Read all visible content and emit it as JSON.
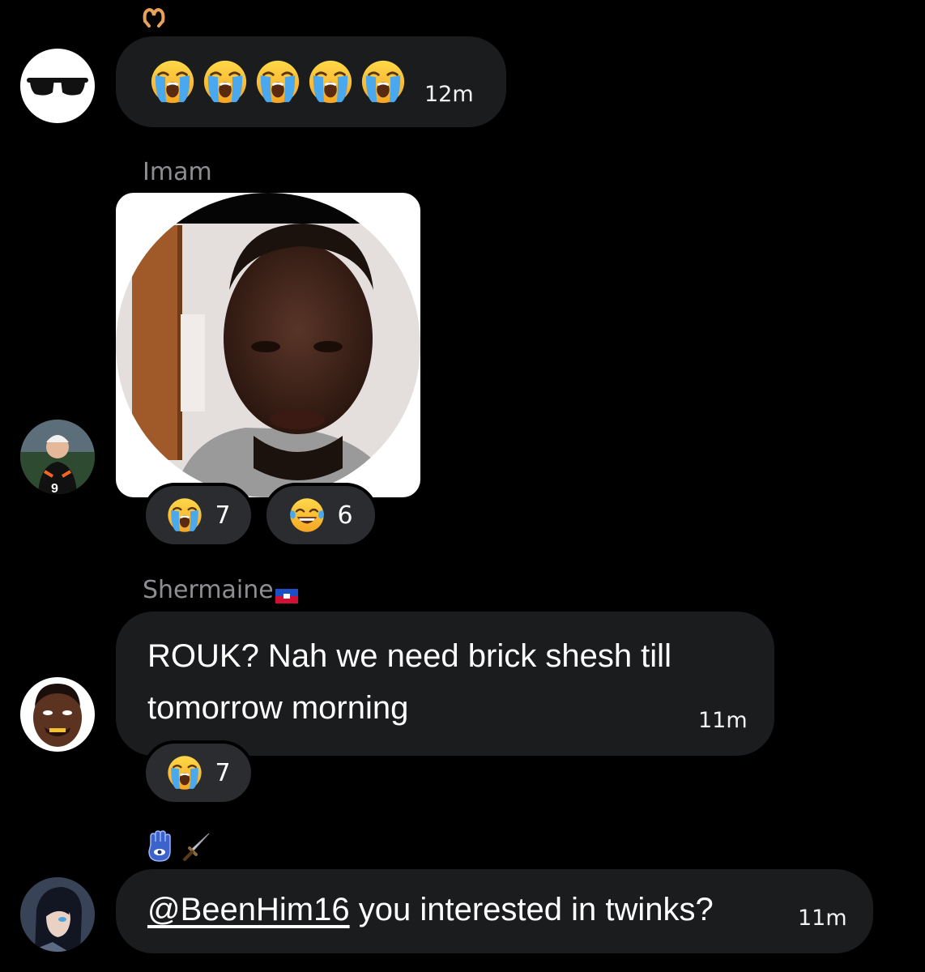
{
  "thread": {
    "messages": [
      {
        "id": "m1",
        "sender": "",
        "avatar_icon": "sunglasses-avatar-icon",
        "header_icon": "heart-hands-icon",
        "emojis": [
          "loudly-crying-face",
          "loudly-crying-face",
          "loudly-crying-face",
          "loudly-crying-face",
          "loudly-crying-face"
        ],
        "timestamp": "12m"
      },
      {
        "id": "m2",
        "sender": "Imam",
        "avatar_icon": "football-player-avatar-icon",
        "attachment": "profile-photo-image",
        "reactions": [
          {
            "icon": "loudly-crying-face",
            "count": "7"
          },
          {
            "icon": "tears-of-joy-face",
            "count": "6"
          }
        ]
      },
      {
        "id": "m3",
        "sender": "Shermaine",
        "sender_flag_icon": "haiti-flag-icon",
        "avatar_icon": "cartoon-avatar-icon",
        "text_lines": [
          "ROUK? Nah we need brick shesh till",
          "tomorrow morning"
        ],
        "timestamp": "11m",
        "reactions": [
          {
            "icon": "loudly-crying-face",
            "count": "7"
          }
        ]
      },
      {
        "id": "m4",
        "sender": "",
        "header_icons": [
          "hamsa-icon",
          "dagger-icon"
        ],
        "avatar_icon": "anime-avatar-icon",
        "mention": "@BeenHim16",
        "text": " you interested in twinks?",
        "timestamp": "11m"
      }
    ]
  },
  "colors": {
    "background": "#000000",
    "bubble": "#1b1c1e",
    "reaction_pill": "#2b2c2f",
    "sender_name": "#8e8e92"
  }
}
